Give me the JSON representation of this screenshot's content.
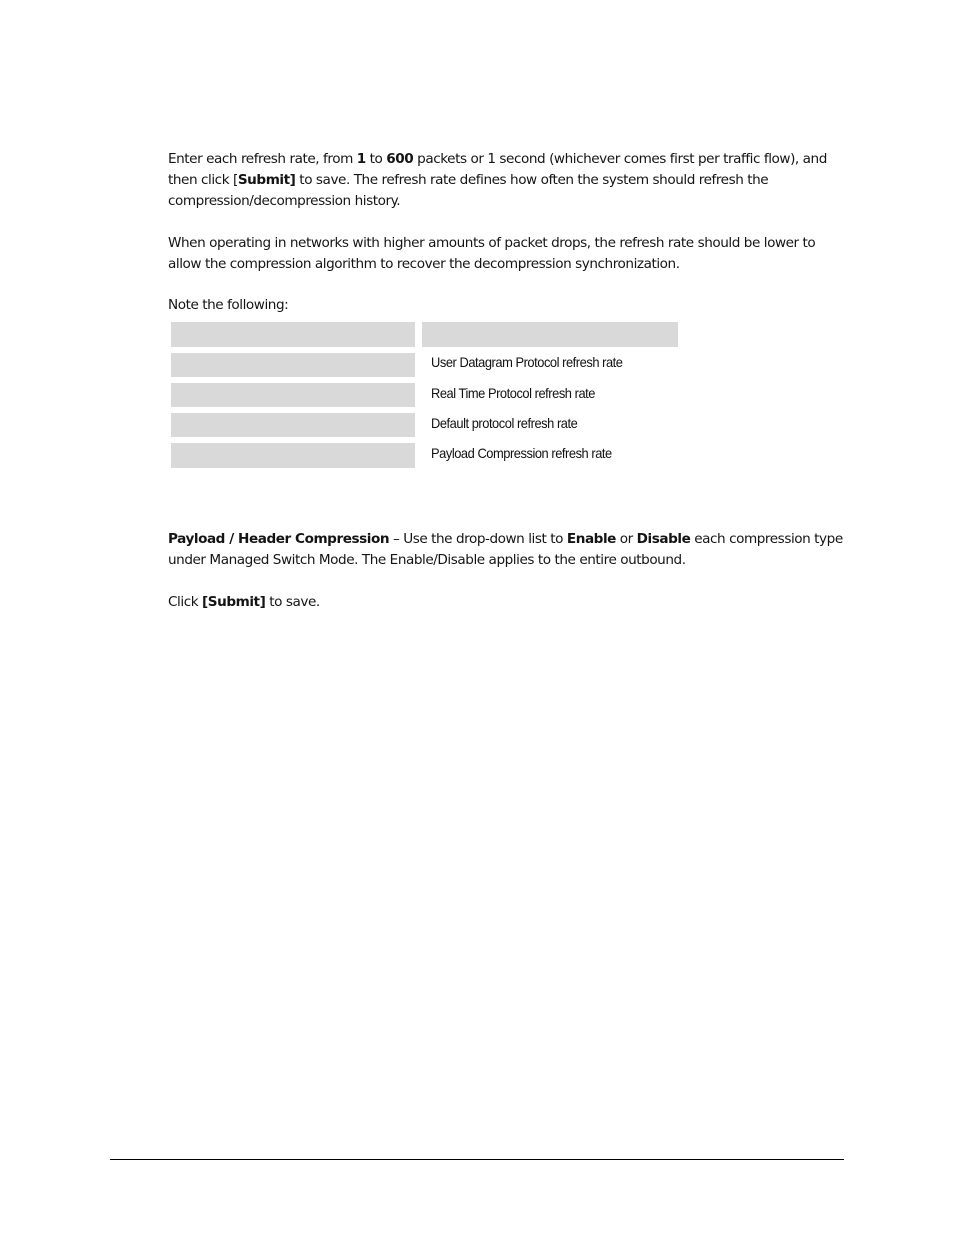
{
  "paragraphs": {
    "refresh_intro": {
      "t1": "Enter each refresh rate, from ",
      "b1": "1",
      "t2": " to ",
      "b2": "600",
      "t3": " packets or 1 second (whichever comes first per traffic flow), and then click [",
      "b3": "Submit]",
      "t4": " to save. The refresh rate defines how often the system should refresh the compression/decompression history."
    },
    "packet_drops": "When operating in networks with higher amounts of packet drops, the refresh rate should be lower to allow the compression algorithm to recover the decompression synchronization.",
    "note_lead": "Note the following:",
    "compression": {
      "b1": "Payload / Header Compression",
      "t1": " – Use the drop-down list to ",
      "b2": "Enable",
      "t2": " or ",
      "b3": "Disable",
      "t3": " each compression type under Managed Switch Mode. The Enable/Disable applies to the entire outbound."
    },
    "submit": {
      "t1": "Click ",
      "b1": "[Submit]",
      "t2": " to save."
    }
  },
  "note_table": {
    "header": [
      "",
      ""
    ],
    "rows": [
      {
        "term": "",
        "description": "User Datagram Protocol refresh rate"
      },
      {
        "term": "",
        "description": "Real Time Protocol refresh rate"
      },
      {
        "term": "",
        "description": "Default protocol refresh rate"
      },
      {
        "term": "",
        "description": "Payload Compression refresh rate"
      }
    ]
  }
}
